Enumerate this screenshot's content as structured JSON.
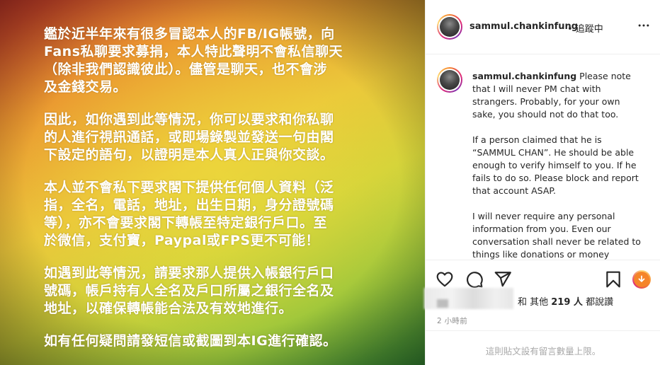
{
  "post_image": {
    "paragraphs": [
      "鑑於近半年來有很多冒認本人的FB/IG帳號，向\nFans私聊要求募捐，本人特此聲明不會私信聊天\n（除非我們認識彼此）。儘管是聊天，也不會涉\n及金錢交易。",
      "因此，如你遇到此等情況，你可以要求和你私聊\n的人進行視訊通話，或即場錄製並發送一句由閣\n下設定的語句，以證明是本人真人正與你交談。",
      "本人並不會私下要求閣下提供任何個人資料（泛\n指，全名，電話，地址，出生日期，身分證號碼\n等），亦不會要求閣下轉帳至特定銀行戶口。至\n於微信，支付寶，Paypal或FPS更不可能！",
      "如遇到此等情況，請要求那人提供入帳銀行戶口\n號碼，帳戶持有人全名及戶口所屬之銀行全名及\n地址，以確保轉帳能合法及有效地進行。",
      "如有任何疑問請發短信或截圖到本IG進行確認。"
    ]
  },
  "header": {
    "username": "sammul.chankinfung",
    "follow_state": "• 追蹤中",
    "more_icon": "more-horizontal-icon"
  },
  "caption": {
    "username": "sammul.chankinfung",
    "first_line": "Please note that I will never PM chat with strangers. Probably, for your own sake, you should not do that too.",
    "paragraph2": "If a person claimed that he is “SAMMUL CHAN”. He should be able enough to verify himself to you. If he fails to do so. Please block and report that account ASAP.",
    "paragraph3": "I will never require any personal information from you. Even our conversation shall never be related to things like donations or money"
  },
  "actions": {
    "like_icon": "heart-icon",
    "comment_icon": "comment-icon",
    "share_icon": "paper-plane-icon",
    "save_icon": "bookmark-icon",
    "reel_icon": "download-circle-icon"
  },
  "likes": {
    "prefix": "和 其他 ",
    "count": "219 人",
    "suffix": " 都說讚"
  },
  "timestamp": "2 小時前",
  "footer": {
    "comments_disabled": "這則貼文設有留言數量上限。"
  },
  "colors": {
    "text": "#262626",
    "muted": "#8e8e8e",
    "border": "#efefef"
  }
}
